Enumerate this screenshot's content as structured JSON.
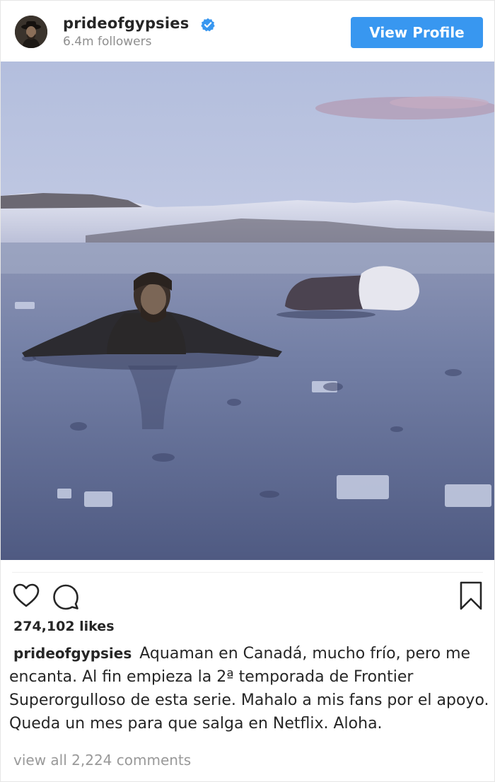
{
  "header": {
    "username": "prideofgypsies",
    "followers": "6.4m followers",
    "view_profile_label": "View Profile"
  },
  "post": {
    "likes": "274,102 likes",
    "caption_user": "prideofgypsies",
    "caption_text": "Aquaman en Canadá, mucho frío, pero me encanta. Al fin empieza la 2ª temporada de Frontier Superorgulloso de esta serie. Mahalo a mis fans por el apoyo. Queda un mes para que salga en Netflix. Aloha.",
    "view_comments": "view all 2,224 comments"
  },
  "icons": {
    "verified": "verified-badge-icon",
    "like": "heart-icon",
    "comment": "comment-bubble-icon",
    "save": "bookmark-icon"
  },
  "colors": {
    "accent": "#3897f0",
    "text": "#262626",
    "muted": "#8e8e8e"
  }
}
